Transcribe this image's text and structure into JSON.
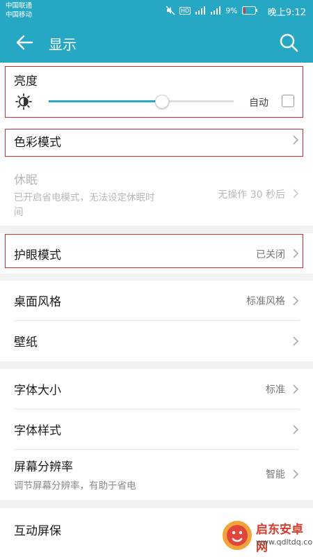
{
  "status_bar": {
    "carrier1": "中国联通",
    "carrier2": "中国移动",
    "hd": "HD",
    "battery": "9%",
    "time": "晚上9:12"
  },
  "app_bar": {
    "title": "显示"
  },
  "brightness": {
    "label": "亮度",
    "level": 0.61,
    "auto_label": "自动",
    "auto_checked": false
  },
  "items": {
    "color_mode": {
      "label": "色彩模式"
    },
    "sleep": {
      "label": "休眠",
      "subtitle_line1": "已开启省电模式，无法设定休眠时",
      "subtitle_line2": "间",
      "value": "无操作 30 秒后",
      "enabled": false
    },
    "eye_comfort": {
      "label": "护眼模式",
      "value": "已关闭"
    },
    "desktop_style": {
      "label": "桌面风格",
      "value": "标准风格"
    },
    "wallpaper": {
      "label": "壁纸"
    },
    "font_size": {
      "label": "字体大小",
      "value": "标准"
    },
    "font_style": {
      "label": "字体样式"
    },
    "resolution": {
      "label": "屏幕分辨率",
      "subtitle": "调节屏幕分辨率，有助于省电",
      "value": "智能"
    },
    "screensaver": {
      "label": "互动屏保"
    }
  },
  "watermark": {
    "name": "启东安卓网",
    "url": "www.qdltdq.com"
  },
  "colors": {
    "accent": "#26a8c4",
    "highlight_box": "#d62a2a"
  }
}
